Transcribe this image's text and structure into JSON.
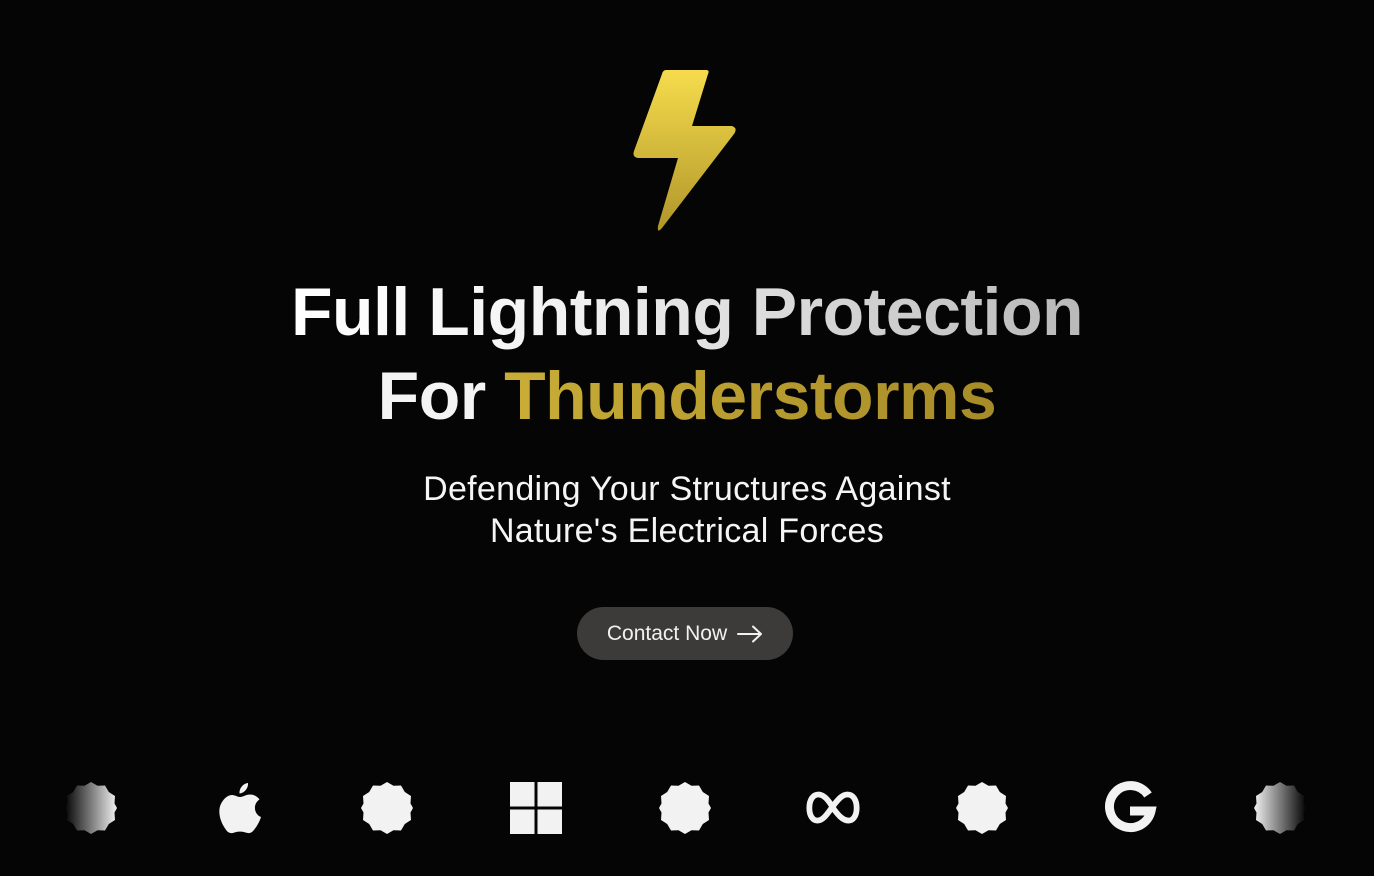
{
  "hero": {
    "headline_line1": "Full Lightning Protection",
    "headline_for": "For",
    "headline_accent": "Thunderstorms",
    "subtitle_line1": "Defending Your Structures Against",
    "subtitle_line2": "Nature's Electrical Forces",
    "cta_label": "Contact Now",
    "icon": "lightning-bolt-icon"
  },
  "logos": [
    {
      "name": "badge-icon"
    },
    {
      "name": "apple-logo-icon"
    },
    {
      "name": "badge-icon"
    },
    {
      "name": "windows-logo-icon"
    },
    {
      "name": "badge-icon"
    },
    {
      "name": "meta-logo-icon"
    },
    {
      "name": "badge-icon"
    },
    {
      "name": "google-logo-icon"
    },
    {
      "name": "badge-icon"
    }
  ],
  "colors": {
    "background": "#050505",
    "accent_gold": "#c9ad37",
    "bolt_top": "#f4d94a",
    "bolt_bottom": "#b59a26",
    "button_bg": "#3d3a3a",
    "text_light": "#f2f2f2"
  }
}
